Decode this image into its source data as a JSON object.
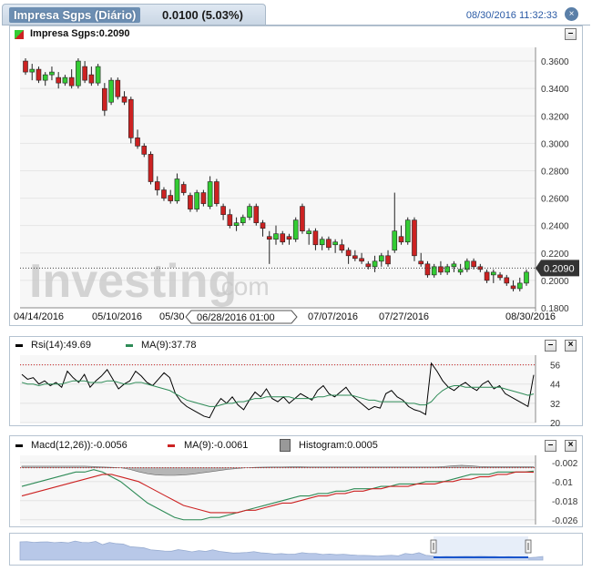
{
  "header": {
    "title": "Impresa Sgps (Diário)",
    "change": "0.0100 (5.03%)",
    "datetime": "08/30/2016 11:32:33",
    "close_label": "×"
  },
  "main_panel": {
    "legend": "Impresa Sgps:0.2090",
    "minimize_label": "–",
    "price_badge": "0.2090",
    "y_ticks": [
      "0.3600",
      "0.3400",
      "0.3200",
      "0.3000",
      "0.2800",
      "0.2600",
      "0.2400",
      "0.2200",
      "0.2000",
      "0.1800"
    ],
    "x_ticks": [
      "04/14/2016",
      "05/10/2016",
      "05/30",
      "07/07/2016",
      "07/27/2016",
      "08/30/2016"
    ],
    "crosshair_label": "06/28/2016 01:00",
    "watermark": "Investing",
    "watermark_suffix": ".com"
  },
  "rsi_panel": {
    "legend_rsi": "Rsi(14):49.69",
    "legend_ma": "MA(9):37.78",
    "y_ticks": [
      "56",
      "44",
      "32",
      "20"
    ],
    "minimize_label": "–",
    "close_label": "×"
  },
  "macd_panel": {
    "legend_macd": "Macd(12,26)):-0.0056",
    "legend_ma": "MA(9):-0.0061",
    "legend_hist": "Histogram:0.0005",
    "y_ticks": [
      "-0.002",
      "-0.01",
      "-0.018",
      "-0.026"
    ],
    "minimize_label": "–",
    "close_label": "×"
  },
  "colors": {
    "up": "#33cc33",
    "down": "#cc2222",
    "rsi_line": "#000000",
    "ma_line": "#2e8b57",
    "macd_line": "#2e8b57",
    "signal_line": "#cc2222",
    "histogram": "#888888",
    "navigator_fill": "#b8c8e8",
    "navigator_selected": "#1a55cc"
  },
  "chart_data": [
    {
      "type": "candlestick",
      "title": "Impresa Sgps",
      "ylim": [
        0.18,
        0.37
      ],
      "x_tick_labels": [
        "04/14/2016",
        "05/10/2016",
        "05/30",
        "07/07/2016",
        "07/27/2016",
        "08/30/2016"
      ],
      "last_value": 0.209,
      "candles": [
        [
          0.36,
          0.362,
          0.35,
          0.352
        ],
        [
          0.352,
          0.358,
          0.346,
          0.354
        ],
        [
          0.354,
          0.356,
          0.344,
          0.346
        ],
        [
          0.346,
          0.352,
          0.342,
          0.35
        ],
        [
          0.35,
          0.356,
          0.346,
          0.352
        ],
        [
          0.348,
          0.352,
          0.34,
          0.344
        ],
        [
          0.344,
          0.35,
          0.342,
          0.348
        ],
        [
          0.348,
          0.354,
          0.34,
          0.342
        ],
        [
          0.342,
          0.362,
          0.34,
          0.36
        ],
        [
          0.356,
          0.36,
          0.344,
          0.346
        ],
        [
          0.35,
          0.356,
          0.342,
          0.344
        ],
        [
          0.344,
          0.358,
          0.342,
          0.356
        ],
        [
          0.34,
          0.344,
          0.32,
          0.324
        ],
        [
          0.33,
          0.348,
          0.328,
          0.346
        ],
        [
          0.346,
          0.348,
          0.332,
          0.334
        ],
        [
          0.334,
          0.338,
          0.328,
          0.33
        ],
        [
          0.332,
          0.334,
          0.3,
          0.304
        ],
        [
          0.304,
          0.31,
          0.296,
          0.298
        ],
        [
          0.298,
          0.3,
          0.29,
          0.292
        ],
        [
          0.292,
          0.294,
          0.27,
          0.272
        ],
        [
          0.272,
          0.276,
          0.262,
          0.266
        ],
        [
          0.266,
          0.268,
          0.258,
          0.26
        ],
        [
          0.262,
          0.266,
          0.256,
          0.258
        ],
        [
          0.258,
          0.278,
          0.256,
          0.274
        ],
        [
          0.27,
          0.272,
          0.262,
          0.264
        ],
        [
          0.262,
          0.264,
          0.25,
          0.252
        ],
        [
          0.252,
          0.266,
          0.25,
          0.264
        ],
        [
          0.264,
          0.266,
          0.254,
          0.256
        ],
        [
          0.254,
          0.276,
          0.252,
          0.272
        ],
        [
          0.272,
          0.274,
          0.254,
          0.256
        ],
        [
          0.254,
          0.256,
          0.244,
          0.248
        ],
        [
          0.248,
          0.252,
          0.238,
          0.24
        ],
        [
          0.24,
          0.246,
          0.236,
          0.242
        ],
        [
          0.242,
          0.248,
          0.24,
          0.246
        ],
        [
          0.246,
          0.256,
          0.244,
          0.254
        ],
        [
          0.254,
          0.256,
          0.24,
          0.242
        ],
        [
          0.242,
          0.244,
          0.232,
          0.238
        ],
        [
          0.232,
          0.236,
          0.212,
          0.23
        ],
        [
          0.23,
          0.24,
          0.226,
          0.234
        ],
        [
          0.234,
          0.236,
          0.226,
          0.228
        ],
        [
          0.232,
          0.234,
          0.226,
          0.23
        ],
        [
          0.23,
          0.246,
          0.228,
          0.244
        ],
        [
          0.254,
          0.256,
          0.234,
          0.236
        ],
        [
          0.234,
          0.238,
          0.226,
          0.236
        ],
        [
          0.236,
          0.238,
          0.222,
          0.226
        ],
        [
          0.226,
          0.232,
          0.222,
          0.23
        ],
        [
          0.23,
          0.232,
          0.222,
          0.224
        ],
        [
          0.226,
          0.23,
          0.22,
          0.228
        ],
        [
          0.226,
          0.23,
          0.22,
          0.222
        ],
        [
          0.222,
          0.224,
          0.212,
          0.218
        ],
        [
          0.218,
          0.222,
          0.214,
          0.216
        ],
        [
          0.216,
          0.22,
          0.212,
          0.214
        ],
        [
          0.212,
          0.214,
          0.208,
          0.21
        ],
        [
          0.21,
          0.218,
          0.206,
          0.214
        ],
        [
          0.214,
          0.22,
          0.21,
          0.218
        ],
        [
          0.218,
          0.222,
          0.21,
          0.212
        ],
        [
          0.222,
          0.264,
          0.22,
          0.236
        ],
        [
          0.232,
          0.24,
          0.226,
          0.228
        ],
        [
          0.228,
          0.246,
          0.226,
          0.244
        ],
        [
          0.244,
          0.246,
          0.214,
          0.218
        ],
        [
          0.214,
          0.22,
          0.21,
          0.212
        ],
        [
          0.212,
          0.214,
          0.202,
          0.204
        ],
        [
          0.204,
          0.212,
          0.202,
          0.21
        ],
        [
          0.21,
          0.214,
          0.204,
          0.206
        ],
        [
          0.206,
          0.212,
          0.204,
          0.21
        ],
        [
          0.21,
          0.214,
          0.206,
          0.212
        ],
        [
          0.206,
          0.212,
          0.204,
          0.208
        ],
        [
          0.208,
          0.216,
          0.206,
          0.214
        ],
        [
          0.214,
          0.216,
          0.208,
          0.21
        ],
        [
          0.21,
          0.212,
          0.206,
          0.208
        ],
        [
          0.206,
          0.208,
          0.198,
          0.2
        ],
        [
          0.204,
          0.208,
          0.198,
          0.206
        ],
        [
          0.204,
          0.206,
          0.2,
          0.202
        ],
        [
          0.202,
          0.204,
          0.196,
          0.198
        ],
        [
          0.196,
          0.2,
          0.192,
          0.194
        ],
        [
          0.194,
          0.202,
          0.192,
          0.198
        ],
        [
          0.198,
          0.208,
          0.196,
          0.206
        ]
      ]
    },
    {
      "type": "line",
      "title": "Rsi(14)",
      "ylim": [
        20,
        62
      ],
      "reference_level": 56,
      "series": [
        {
          "name": "Rsi(14)",
          "values": [
            50,
            47,
            48,
            44,
            46,
            43,
            45,
            42,
            52,
            48,
            45,
            50,
            42,
            46,
            49,
            53,
            47,
            41,
            44,
            46,
            52,
            49,
            45,
            43,
            47,
            51,
            48,
            38,
            33,
            30,
            28,
            26,
            24,
            23,
            30,
            35,
            32,
            36,
            31,
            28,
            34,
            39,
            36,
            41,
            35,
            33,
            36,
            32,
            35,
            38,
            36,
            34,
            40,
            43,
            38,
            36,
            39,
            42,
            37,
            34,
            31,
            28,
            30,
            29,
            38,
            40,
            36,
            34,
            30,
            28,
            27,
            25,
            57,
            52,
            46,
            42,
            40,
            43,
            45,
            42,
            40,
            44,
            46,
            41,
            43,
            38,
            36,
            34,
            32,
            30,
            49.69
          ]
        },
        {
          "name": "MA(9)",
          "values": [
            45,
            44,
            44,
            43,
            44,
            44,
            44,
            44,
            45,
            46,
            46,
            46,
            45,
            45,
            45,
            46,
            46,
            45,
            44,
            44,
            45,
            45,
            44,
            43,
            42,
            41,
            40,
            38,
            36,
            34,
            33,
            32,
            31,
            30,
            30,
            31,
            32,
            32,
            33,
            33,
            34,
            35,
            35,
            36,
            36,
            36,
            36,
            36,
            35,
            35,
            35,
            35,
            36,
            36,
            37,
            37,
            37,
            37,
            37,
            36,
            35,
            34,
            34,
            33,
            33,
            33,
            33,
            33,
            32,
            32,
            31,
            31,
            33,
            37,
            40,
            42,
            43,
            43,
            42,
            42,
            42,
            42,
            42,
            42,
            42,
            41,
            40,
            39,
            38,
            37,
            37.78
          ]
        }
      ]
    },
    {
      "type": "line",
      "title": "Macd(12,26)",
      "ylim": [
        -0.028,
        0.001
      ],
      "series": [
        {
          "name": "Macd(12,26)",
          "values": [
            -0.012,
            -0.011,
            -0.01,
            -0.009,
            -0.008,
            -0.007,
            -0.006,
            -0.006,
            -0.005,
            -0.006,
            -0.008,
            -0.01,
            -0.013,
            -0.016,
            -0.019,
            -0.021,
            -0.023,
            -0.025,
            -0.026,
            -0.026,
            -0.026,
            -0.025,
            -0.025,
            -0.024,
            -0.023,
            -0.022,
            -0.021,
            -0.02,
            -0.019,
            -0.018,
            -0.017,
            -0.016,
            -0.016,
            -0.015,
            -0.015,
            -0.014,
            -0.014,
            -0.013,
            -0.013,
            -0.013,
            -0.012,
            -0.012,
            -0.011,
            -0.011,
            -0.011,
            -0.01,
            -0.01,
            -0.01,
            -0.009,
            -0.008,
            -0.007,
            -0.007,
            -0.007,
            -0.006,
            -0.006,
            -0.006,
            -0.006,
            -0.0056
          ]
        },
        {
          "name": "MA(9)",
          "values": [
            -0.016,
            -0.015,
            -0.014,
            -0.013,
            -0.012,
            -0.011,
            -0.01,
            -0.009,
            -0.008,
            -0.007,
            -0.007,
            -0.008,
            -0.009,
            -0.01,
            -0.012,
            -0.014,
            -0.016,
            -0.018,
            -0.02,
            -0.021,
            -0.022,
            -0.023,
            -0.023,
            -0.023,
            -0.023,
            -0.022,
            -0.022,
            -0.021,
            -0.02,
            -0.019,
            -0.019,
            -0.018,
            -0.017,
            -0.016,
            -0.016,
            -0.015,
            -0.015,
            -0.014,
            -0.014,
            -0.013,
            -0.013,
            -0.012,
            -0.012,
            -0.012,
            -0.011,
            -0.011,
            -0.011,
            -0.01,
            -0.01,
            -0.009,
            -0.009,
            -0.008,
            -0.008,
            -0.007,
            -0.007,
            -0.006,
            -0.006,
            -0.0061
          ]
        },
        {
          "name": "Histogram",
          "values": [
            0.0008,
            0.0008,
            0.0008,
            0.0008,
            0.0008,
            0.0008,
            0.0008,
            0.0008,
            0.0006,
            0.0004,
            0.0002,
            0.0,
            -0.0008,
            -0.002,
            -0.003,
            -0.0036,
            -0.0038,
            -0.0038,
            -0.0036,
            -0.0032,
            -0.0026,
            -0.002,
            -0.0014,
            -0.0008,
            -0.0004,
            0.0,
            0.0002,
            0.0003,
            0.0004,
            0.0004,
            0.0005,
            0.0005,
            0.0004,
            0.0004,
            0.0004,
            0.0004,
            0.0004,
            0.0004,
            0.0004,
            0.0004,
            0.0004,
            0.0004,
            0.0004,
            0.0004,
            0.0004,
            0.0004,
            0.0004,
            0.0006,
            0.001,
            0.0012,
            0.001,
            0.0006,
            0.0005,
            0.0005,
            0.0005,
            0.0005,
            0.0005,
            0.0005
          ]
        }
      ]
    }
  ]
}
